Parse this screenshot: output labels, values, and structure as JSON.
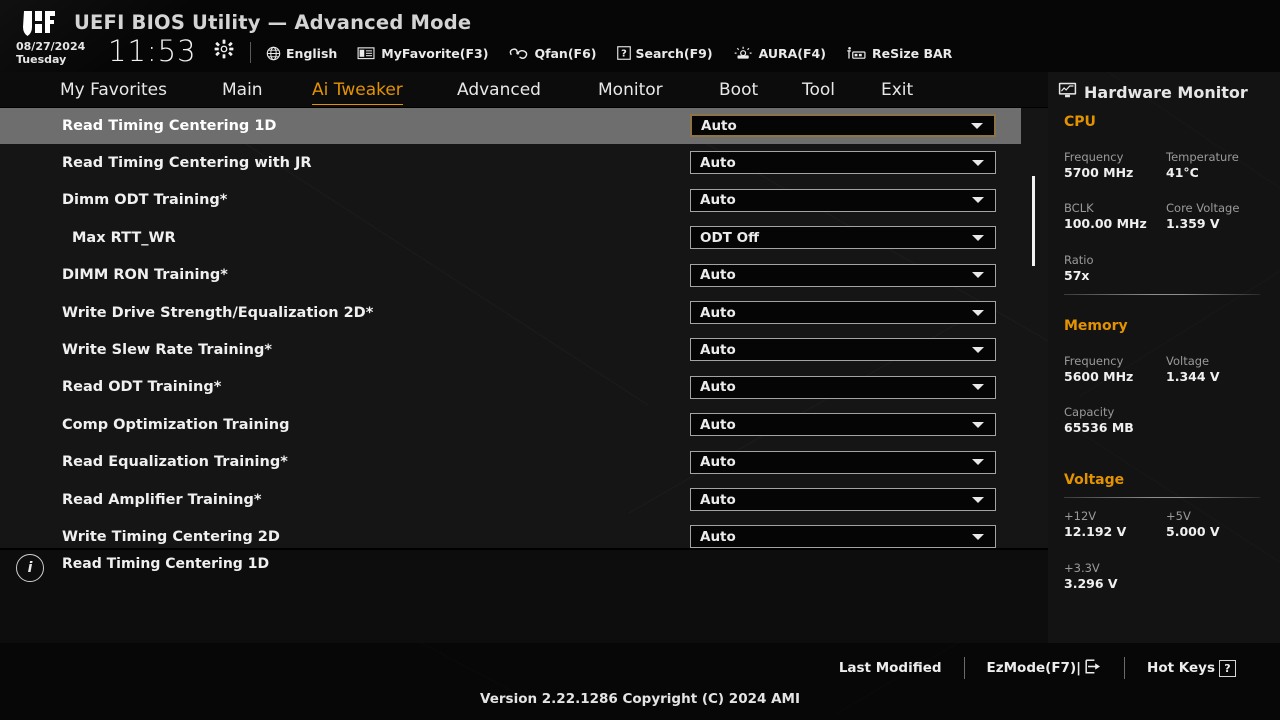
{
  "header": {
    "logo_icon": "tuf-shield-logo",
    "title": "UEFI BIOS Utility — Advanced Mode",
    "date": "08/27/2024",
    "weekday": "Tuesday",
    "time": "11:53",
    "gear_icon": "gear-icon",
    "tools": [
      {
        "label": "English",
        "icon": "globe-icon"
      },
      {
        "label": "MyFavorite(F3)",
        "icon": "favorites-list-icon"
      },
      {
        "label": "Qfan(F6)",
        "icon": "fan-icon"
      },
      {
        "label": "Search(F9)",
        "icon": "question-box-icon"
      },
      {
        "label": "AURA(F4)",
        "icon": "aura-light-icon"
      },
      {
        "label": "ReSize BAR",
        "icon": "resize-bar-icon"
      }
    ]
  },
  "nav": {
    "active": "Ai Tweaker",
    "items": [
      {
        "label": "My Favorites"
      },
      {
        "label": "Main"
      },
      {
        "label": "Ai Tweaker"
      },
      {
        "label": "Advanced"
      },
      {
        "label": "Monitor"
      },
      {
        "label": "Boot"
      },
      {
        "label": "Tool"
      },
      {
        "label": "Exit"
      }
    ]
  },
  "settings": {
    "selected_index": 0,
    "rows": [
      {
        "label": "Read Timing Centering 1D",
        "value": "Auto",
        "indent": false,
        "selected": true
      },
      {
        "label": "Read Timing Centering with JR",
        "value": "Auto",
        "indent": false,
        "selected": false
      },
      {
        "label": "Dimm ODT Training*",
        "value": "Auto",
        "indent": false,
        "selected": false
      },
      {
        "label": "Max RTT_WR",
        "value": "ODT Off",
        "indent": true,
        "selected": false
      },
      {
        "label": "DIMM RON Training*",
        "value": "Auto",
        "indent": false,
        "selected": false
      },
      {
        "label": "Write Drive Strength/Equalization 2D*",
        "value": "Auto",
        "indent": false,
        "selected": false
      },
      {
        "label": "Write Slew Rate Training*",
        "value": "Auto",
        "indent": false,
        "selected": false
      },
      {
        "label": "Read ODT Training*",
        "value": "Auto",
        "indent": false,
        "selected": false
      },
      {
        "label": "Comp Optimization Training",
        "value": "Auto",
        "indent": false,
        "selected": false
      },
      {
        "label": "Read Equalization Training*",
        "value": "Auto",
        "indent": false,
        "selected": false
      },
      {
        "label": "Read Amplifier Training*",
        "value": "Auto",
        "indent": false,
        "selected": false
      },
      {
        "label": "Write Timing Centering 2D",
        "value": "Auto",
        "indent": false,
        "selected": false
      }
    ]
  },
  "help": {
    "icon": "info-icon",
    "text": "Read Timing Centering 1D"
  },
  "hardware_monitor": {
    "title": "Hardware Monitor",
    "icon": "monitor-icon",
    "sections": [
      {
        "name": "CPU",
        "fields": [
          {
            "key": "Frequency",
            "value": "5700 MHz"
          },
          {
            "key": "Temperature",
            "value": "41°C"
          },
          {
            "key": "BCLK",
            "value": "100.00 MHz"
          },
          {
            "key": "Core Voltage",
            "value": "1.359 V"
          },
          {
            "key": "Ratio",
            "value": "57x"
          }
        ]
      },
      {
        "name": "Memory",
        "fields": [
          {
            "key": "Frequency",
            "value": "5600 MHz"
          },
          {
            "key": "Voltage",
            "value": "1.344 V"
          },
          {
            "key": "Capacity",
            "value": "65536 MB"
          }
        ]
      },
      {
        "name": "Voltage",
        "fields": [
          {
            "key": "+12V",
            "value": "12.192 V"
          },
          {
            "key": "+5V",
            "value": "5.000 V"
          },
          {
            "key": "+3.3V",
            "value": "3.296 V"
          }
        ]
      }
    ]
  },
  "footer": {
    "links": [
      {
        "label": "Last Modified",
        "icon": ""
      },
      {
        "label": "EzMode(F7)|",
        "icon": "exit-arrow-icon"
      },
      {
        "label": "Hot Keys",
        "icon": "question-box-icon"
      }
    ],
    "version": "Version 2.22.1286 Copyright (C) 2024 AMI"
  },
  "colors": {
    "accent": "#e39300",
    "selected_row_bg": "#6e6e6e",
    "selected_dropdown_border": "#8c7448",
    "panel_bg": "#151515"
  }
}
